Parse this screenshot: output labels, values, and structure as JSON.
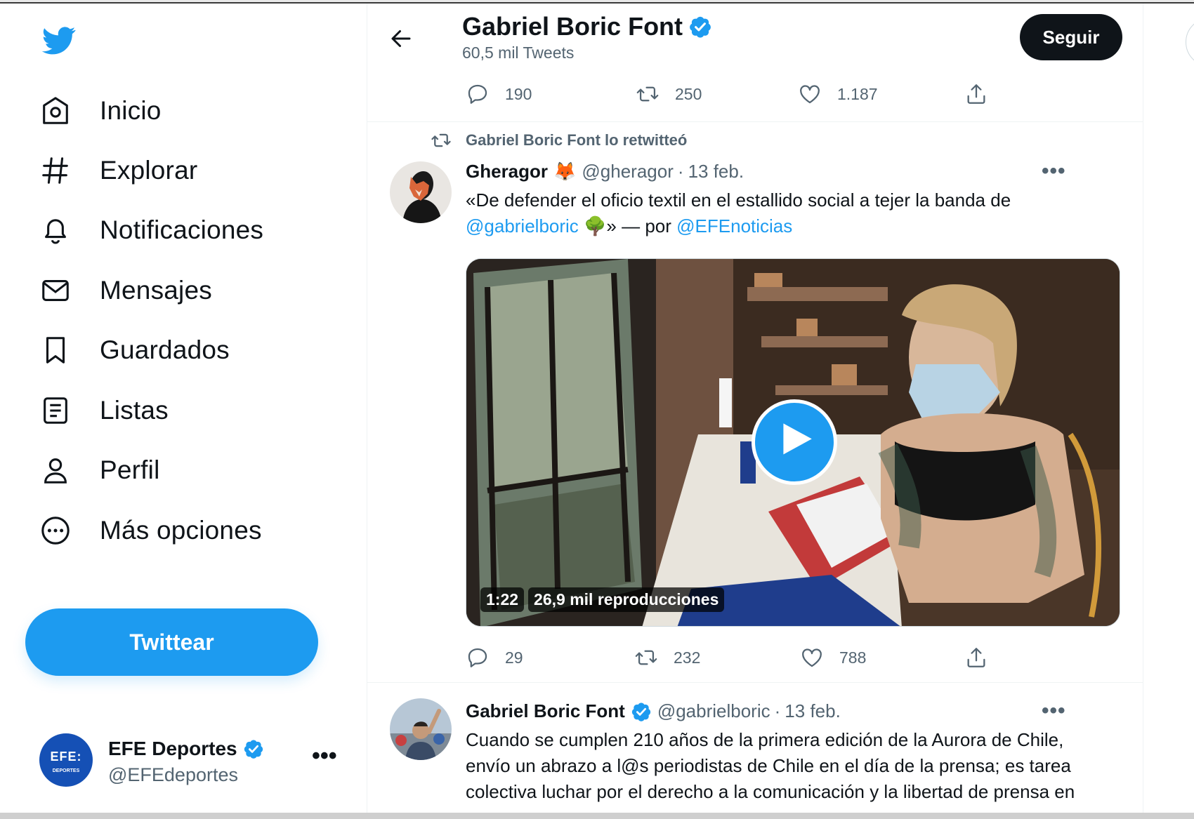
{
  "sidebar": {
    "logo_icon": "twitter-bird-icon",
    "nav": [
      {
        "label": "Inicio",
        "icon": "home-icon"
      },
      {
        "label": "Explorar",
        "icon": "hashtag-icon"
      },
      {
        "label": "Notificaciones",
        "icon": "bell-icon"
      },
      {
        "label": "Mensajes",
        "icon": "envelope-icon"
      },
      {
        "label": "Guardados",
        "icon": "bookmark-icon"
      },
      {
        "label": "Listas",
        "icon": "list-icon"
      },
      {
        "label": "Perfil",
        "icon": "person-icon"
      },
      {
        "label": "Más opciones",
        "icon": "more-circle-icon"
      }
    ],
    "tweet_button": "Twittear",
    "account": {
      "name": "EFE Deportes",
      "handle": "@EFEdeportes",
      "avatar_text": "EFE:",
      "avatar_sub": "DEPORTES",
      "more": "•••"
    }
  },
  "header": {
    "title": "Gabriel Boric Font",
    "subtitle": "60,5 mil Tweets",
    "follow_label": "Seguir"
  },
  "top_actions": {
    "replies": "190",
    "retweets": "250",
    "likes": "1.187"
  },
  "retweet_tweet": {
    "retweeted_by": "Gabriel Boric Font lo retwitteó",
    "name": "Gheragor",
    "emoji": "🦊",
    "handle": "@gheragor",
    "date": "13 feb.",
    "text_1": "«De defender el oficio textil en el estallido social a tejer la banda de",
    "mention_1": "@gabrielboric",
    "emoji_2": "🌳",
    "text_2": "» — por",
    "mention_2": "@EFEnoticias",
    "video": {
      "duration": "1:22",
      "views": "26,9 mil reproducciones"
    },
    "actions": {
      "replies": "29",
      "retweets": "232",
      "likes": "788"
    },
    "more": "•••"
  },
  "second_tweet": {
    "name": "Gabriel Boric Font",
    "handle": "@gabrielboric",
    "date": "13 feb.",
    "text": "Cuando se cumplen 210 años de la primera edición de la Aurora de Chile, envío un abrazo a l@s periodistas de Chile en el día de la prensa; es tarea colectiva luchar por el derecho a la comunicación y la libertad de prensa en",
    "more": "•••"
  },
  "colors": {
    "accent": "#1d9bf0",
    "text": "#0f1419",
    "secondary": "#536471",
    "dark_button": "#0f1419"
  }
}
